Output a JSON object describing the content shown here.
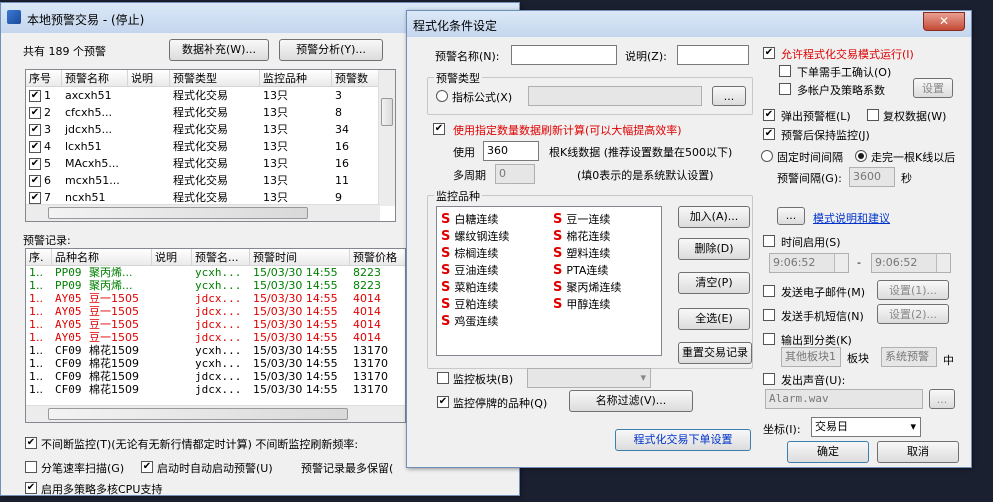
{
  "left_window": {
    "title": "本地预警交易 - (停止)",
    "count_text": "共有 189 个预警",
    "btn_supplement": "数据补充(W)...",
    "btn_analysis": "预警分析(Y)...",
    "columns": [
      "序号",
      "预警名称",
      "说明",
      "预警类型",
      "监控品种",
      "预警数"
    ],
    "rows": [
      {
        "no": "1",
        "name": "axcxh51",
        "type": "程式化交易",
        "inst": "13只",
        "cnt": "3"
      },
      {
        "no": "2",
        "name": "cfcxh5...",
        "type": "程式化交易",
        "inst": "13只",
        "cnt": "8"
      },
      {
        "no": "3",
        "name": "jdcxh5...",
        "type": "程式化交易",
        "inst": "13只",
        "cnt": "34"
      },
      {
        "no": "4",
        "name": "lcxh51",
        "type": "程式化交易",
        "inst": "13只",
        "cnt": "16"
      },
      {
        "no": "5",
        "name": "MAcxh5...",
        "type": "程式化交易",
        "inst": "13只",
        "cnt": "16"
      },
      {
        "no": "6",
        "name": "mcxh51...",
        "type": "程式化交易",
        "inst": "13只",
        "cnt": "11"
      },
      {
        "no": "7",
        "name": "ncxh51",
        "type": "程式化交易",
        "inst": "13只",
        "cnt": "9"
      }
    ],
    "records_label": "预警记录:",
    "rec_columns": [
      "序.",
      "品种名称",
      "说明",
      "预警名...",
      "预警时间",
      "预警价格"
    ],
    "records": [
      {
        "no": "1..",
        "code": "PP09",
        "name": "聚丙烯...",
        "alert": "ycxh...",
        "time": "15/03/30 14:55",
        "price": "8223",
        "color": "grn"
      },
      {
        "no": "1..",
        "code": "PP09",
        "name": "聚丙烯...",
        "alert": "ycxh...",
        "time": "15/03/30 14:55",
        "price": "8223",
        "color": "grn"
      },
      {
        "no": "1..",
        "code": "AY05",
        "name": "豆一1505",
        "alert": "jdcx...",
        "time": "15/03/30 14:55",
        "price": "4014",
        "color": "red"
      },
      {
        "no": "1..",
        "code": "AY05",
        "name": "豆一1505",
        "alert": "jdcx...",
        "time": "15/03/30 14:55",
        "price": "4014",
        "color": "red"
      },
      {
        "no": "1..",
        "code": "AY05",
        "name": "豆一1505",
        "alert": "jdcx...",
        "time": "15/03/30 14:55",
        "price": "4014",
        "color": "red"
      },
      {
        "no": "1..",
        "code": "AY05",
        "name": "豆一1505",
        "alert": "jdcx...",
        "time": "15/03/30 14:55",
        "price": "4014",
        "color": "red"
      },
      {
        "no": "1..",
        "code": "CF09",
        "name": "棉花1509",
        "alert": "ycxh...",
        "time": "15/03/30 14:55",
        "price": "13170",
        "color": "blk"
      },
      {
        "no": "1..",
        "code": "CF09",
        "name": "棉花1509",
        "alert": "ycxh...",
        "time": "15/03/30 14:55",
        "price": "13170",
        "color": "blk"
      },
      {
        "no": "1..",
        "code": "CF09",
        "name": "棉花1509",
        "alert": "jdcx...",
        "time": "15/03/30 14:55",
        "price": "13170",
        "color": "blk"
      },
      {
        "no": "1..",
        "code": "CF09",
        "name": "棉花1509",
        "alert": "jdcx...",
        "time": "15/03/30 14:55",
        "price": "13170",
        "color": "blk"
      }
    ],
    "opt_continuous": "不间断监控(T)(无论有无新行情都定时计算)  不间断监控刷新频率:",
    "opt_tick": "分笔速率扫描(G)",
    "opt_autostart": "启动时自动启动预警(U)",
    "opt_max": "预警记录最多保留(",
    "opt_multicore": "启用多策略多核CPU支持"
  },
  "dialog": {
    "title": "程式化条件设定",
    "name_label": "预警名称(N):",
    "name_value": "",
    "desc_label": "说明(Z):",
    "desc_value": "",
    "type_group": "预警类型",
    "type_formula": "指标公式(X)",
    "browse": "...",
    "use_count": "使用指定数量数据刷新计算(可以大幅提高效率)",
    "use_label": "使用",
    "use_value": "360",
    "kline_text": "根K线数据 (推荐设置数量在500以下)",
    "multi_label": "多周期",
    "multi_value": "0",
    "multi_note": "(填0表示的是系统默认设置)",
    "inst_group": "监控品种",
    "inst_left": [
      "白糖连续",
      "螺纹钢连续",
      "棕榈连续",
      "豆油连续",
      "菜粕连续",
      "豆粕连续",
      "鸡蛋连续"
    ],
    "inst_right": [
      "豆一连续",
      "棉花连续",
      "塑料连续",
      "PTA连续",
      "聚丙烯连续",
      "甲醇连续"
    ],
    "inst_marker": "S",
    "btn_add": "加入(A)...",
    "btn_delete": "删除(D)",
    "btn_clear": "清空(P)",
    "btn_selall": "全选(E)",
    "btn_reset": "重置交易记录",
    "monitor_board": "监控板块(B)",
    "monitor_halted": "监控停牌的品种(Q)",
    "btn_filter": "名称过滤(V)...",
    "btn_order": "程式化交易下单设置",
    "allow_auto": "允许程式化交易模式运行(I)",
    "manual_confirm": "下单需手工确认(O)",
    "multi_account": "多帐户及策略系数",
    "btn_settings": "设置",
    "popup": "弹出预警框(L)",
    "restore": "复权数据(W)",
    "keep_monitor": "预警后保持监控(J)",
    "fixed_interval": "固定时间间隔",
    "per_kline": "走完一根K线以后",
    "interval_label": "预警间隔(G):",
    "interval_value": "3600",
    "interval_unit": "秒",
    "btn_dots": "...",
    "model_link": "模式说明和建议",
    "time_enable": "时间启用(S)",
    "time_from": "9:06:52",
    "time_to": "9:06:52",
    "dash": "-",
    "email": "发送电子邮件(M)",
    "btn_set1": "设置(1)...",
    "sms": "发送手机短信(N)",
    "btn_set2": "设置(2)...",
    "output_cat": "输出到分类(K)",
    "cat_value": "其他板块1",
    "board_label": "板块",
    "board_value": "系统预警",
    "board_suffix": "中",
    "sound": "发出声音(U):",
    "sound_file": "Alarm.wav",
    "coord_label": "坐标(I):",
    "coord_value": "交易日",
    "btn_ok": "确定",
    "btn_cancel": "取消"
  }
}
